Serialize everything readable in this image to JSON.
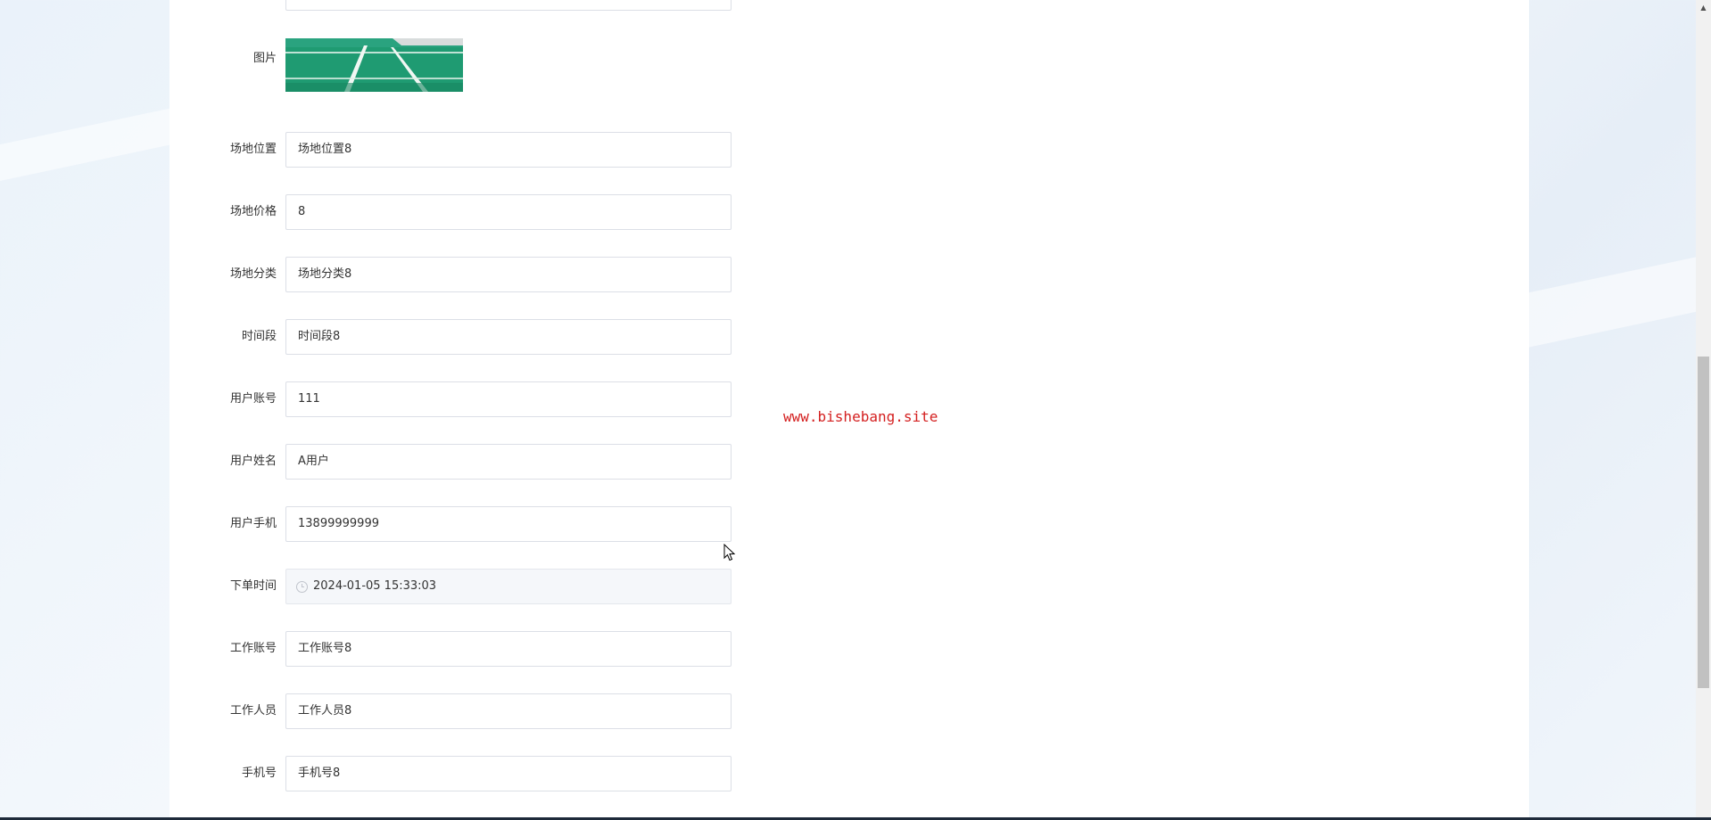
{
  "form": {
    "image_label": "图片",
    "fields": [
      {
        "label": "场地位置",
        "value": "场地位置8"
      },
      {
        "label": "场地价格",
        "value": "8"
      },
      {
        "label": "场地分类",
        "value": "场地分类8"
      },
      {
        "label": "时间段",
        "value": "时间段8"
      },
      {
        "label": "用户账号",
        "value": "111"
      },
      {
        "label": "用户姓名",
        "value": "A用户"
      },
      {
        "label": "用户手机",
        "value": "13899999999"
      },
      {
        "label": "下单时间",
        "value": "2024-01-05 15:33:03",
        "disabled": true,
        "icon": "clock-icon"
      },
      {
        "label": "工作账号",
        "value": "工作账号8"
      },
      {
        "label": "工作人员",
        "value": "工作人员8"
      },
      {
        "label": "手机号",
        "value": "手机号8"
      }
    ]
  },
  "watermark": "www.bishebang.site",
  "colors": {
    "court_green": "#1f9b72",
    "watermark": "#d42020"
  }
}
